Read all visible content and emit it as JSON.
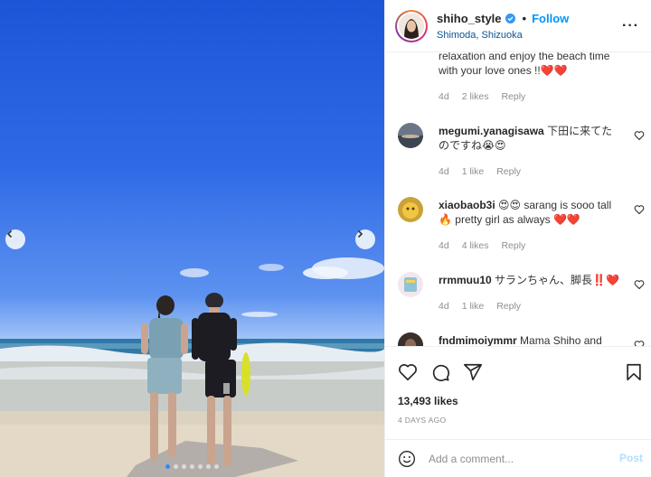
{
  "photo": {
    "slides_count": 7,
    "active_slide": 1
  },
  "header": {
    "username": "shiho_style",
    "separator": "•",
    "follow_label": "Follow",
    "location": "Shimoda, Shizuoka",
    "more": "···"
  },
  "comments": {
    "continued": {
      "text": "relaxation and enjoy the beach time with your love ones !!❤️❤️",
      "time": "4d",
      "likes": "2 likes",
      "reply": "Reply"
    },
    "items": [
      {
        "username": "megumi.yanagisawa",
        "text": "下田に来てたのですね😭😍",
        "time": "4d",
        "likes": "1 like",
        "reply": "Reply"
      },
      {
        "username": "xiaobaob3i",
        "text": "😍😍 sarang is sooo tall 🔥 pretty girl as always ❤️❤️",
        "time": "4d",
        "likes": "4 likes",
        "reply": "Reply"
      },
      {
        "username": "rrmmuu10",
        "text": "サランちゃん、脚長‼️❤️",
        "time": "4d",
        "likes": "1 like",
        "reply": "Reply"
      },
      {
        "username": "fndmimoiymmr",
        "text": "Mama Shiho and",
        "time": "",
        "likes": "",
        "reply": ""
      }
    ]
  },
  "actions": {
    "likes_count": "13,493 likes",
    "date": "4 DAYS AGO"
  },
  "add_comment": {
    "placeholder": "Add a comment...",
    "post_label": "Post"
  },
  "colors": {
    "accent": "#0095f6",
    "location": "#0b5394",
    "muted": "#8e8e8e",
    "post_disabled": "#b2dffc"
  }
}
